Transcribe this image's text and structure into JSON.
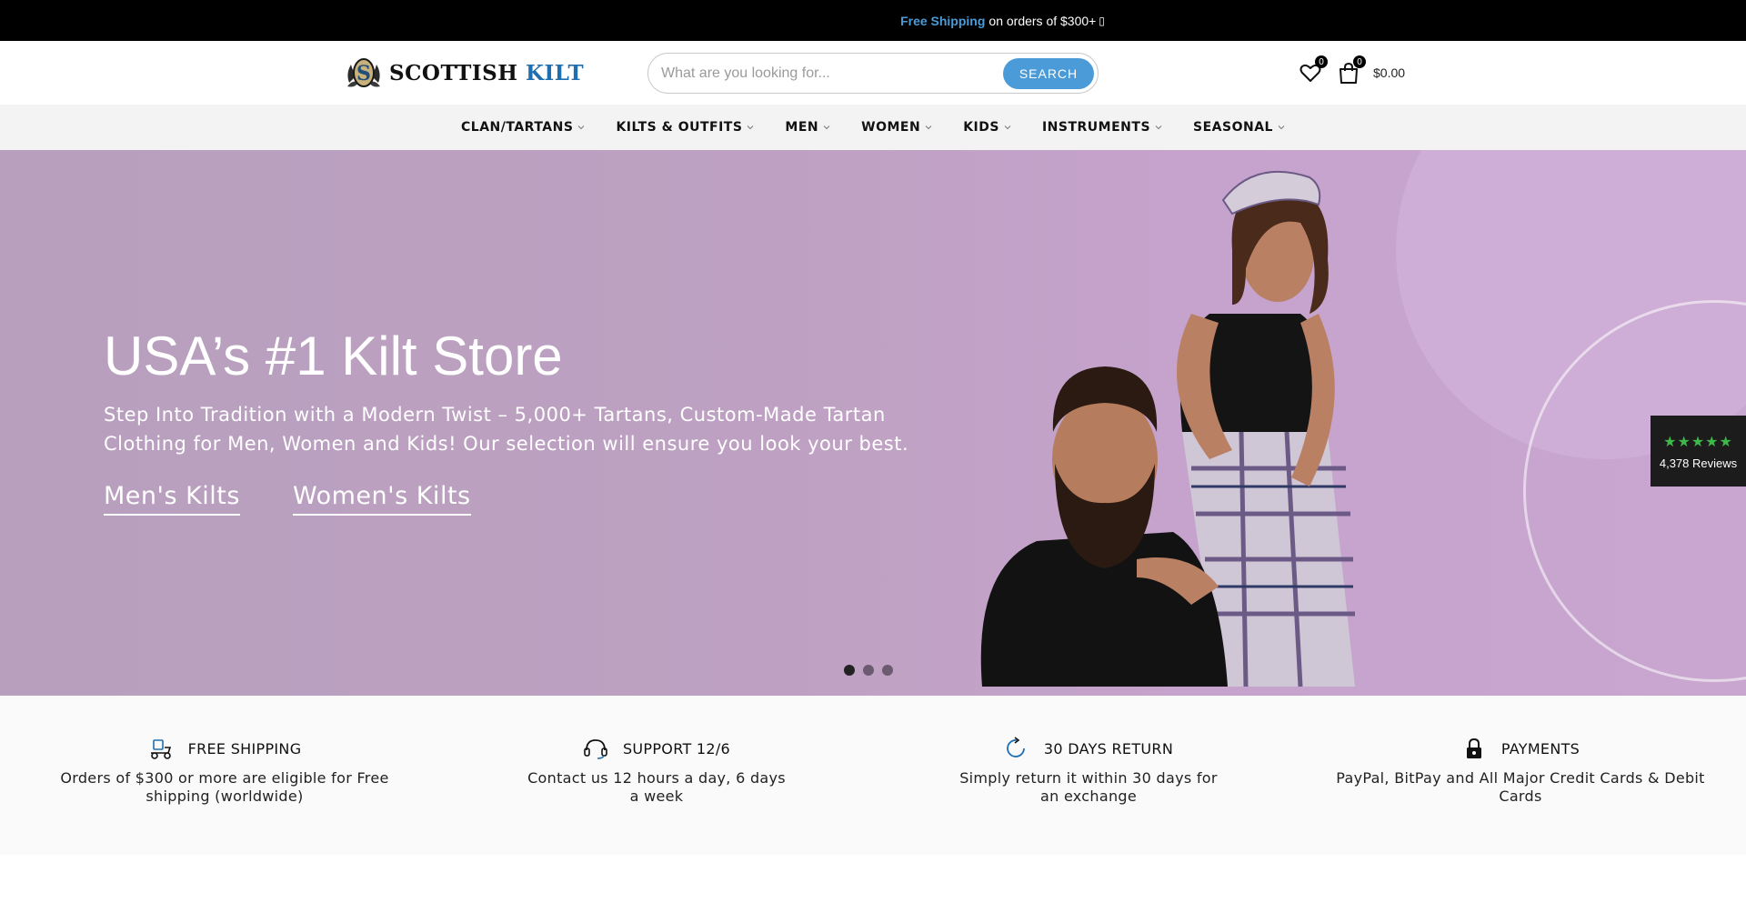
{
  "announcement": {
    "highlight": "Free Shipping",
    "text": "on orders of $300+",
    "trailing_glyph": "▯"
  },
  "header": {
    "logo": {
      "word1": "SCOTTISH",
      "word2": "KILT",
      "badge_icon": "thistle-s-emblem-icon"
    },
    "search": {
      "placeholder": "What are you looking for...",
      "value": "",
      "button_label": "SEARCH"
    },
    "wishlist": {
      "icon": "heart-icon",
      "count": "0"
    },
    "cart": {
      "icon": "shopping-bag-icon",
      "count": "0",
      "total": "$0.00"
    }
  },
  "nav": {
    "items": [
      {
        "label": "CLAN/TARTANS"
      },
      {
        "label": "KILTS & OUTFITS"
      },
      {
        "label": "MEN"
      },
      {
        "label": "WOMEN"
      },
      {
        "label": "KIDS"
      },
      {
        "label": "INSTRUMENTS"
      },
      {
        "label": "SEASONAL"
      }
    ]
  },
  "hero": {
    "title": "USA’s #1 Kilt Store",
    "subtitle": "Step Into Tradition with a Modern Twist – 5,000+ Tartans, Custom-Made Tartan Clothing for Men, Women and Kids! Our selection will ensure you look your best.",
    "links": [
      {
        "label": "Men's Kilts"
      },
      {
        "label": "Women's Kilts"
      }
    ],
    "slides": {
      "count": 3,
      "active": 1
    }
  },
  "reviews": {
    "stars": "★★★★★",
    "rating_shown": 4.5,
    "count": "4,378 Reviews"
  },
  "features": [
    {
      "icon": "delivery-scooter-icon",
      "title": "FREE SHIPPING",
      "desc": "Orders of $300 or more are eligible for Free shipping (worldwide)"
    },
    {
      "icon": "headset-icon",
      "title": "SUPPORT 12/6",
      "desc": "Contact us 12 hours a day, 6 days a week"
    },
    {
      "icon": "return-arrow-icon",
      "title": "30 DAYS RETURN",
      "desc": "Simply return it within 30 days for an exchange"
    },
    {
      "icon": "padlock-icon",
      "title": "PAYMENTS",
      "desc": "PayPal, BitPay and All Major Credit Cards & Debit Cards"
    }
  ],
  "colors": {
    "accent": "#4a9bd8",
    "logo_blue": "#1f6fb0",
    "hero_bg": "#bea1c2",
    "reviews_star": "#3fb84a",
    "dot_active": "#222222",
    "dot_inactive": "#6b5a70"
  }
}
